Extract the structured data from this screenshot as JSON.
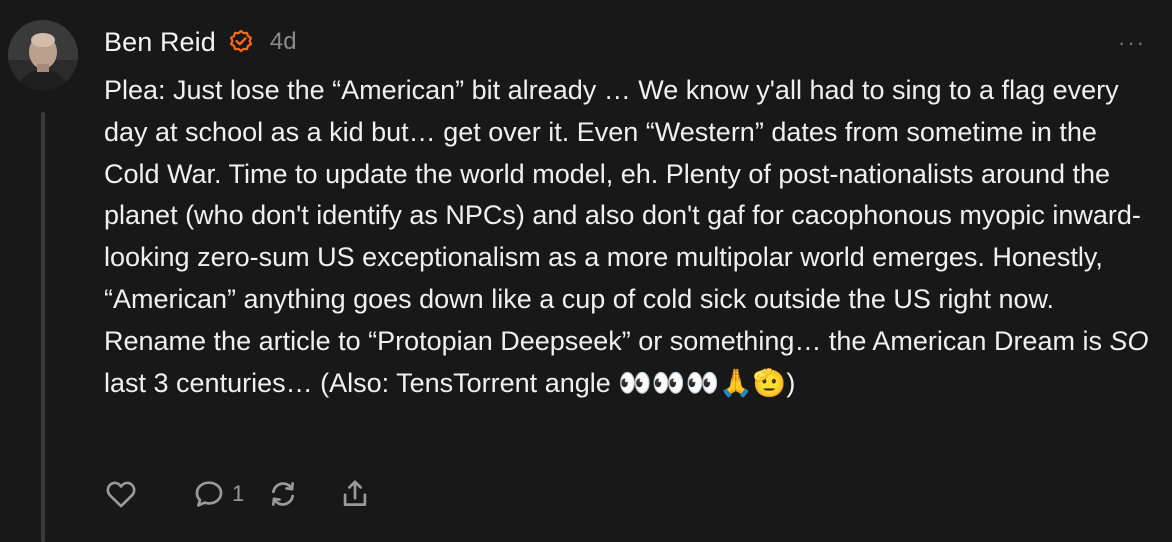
{
  "comment": {
    "author": "Ben Reid",
    "verified_icon": "verified-check-icon",
    "time_ago": "4d",
    "more_icon": "ellipsis-icon",
    "more_label": "···",
    "body_part1": "Plea: Just lose the “American” bit already … We know y'all had to sing to a flag every day at school as a kid but… get over it. Even “Western” dates from sometime in the Cold War. Time to update the world model, eh. Plenty of post-nationalists around the planet (who don't identify as NPCs) and also don't gaf for cacophonous myopic inward-looking zero-sum US exceptionalism as a more multipolar world emerges. Honestly, “American” anything goes down like a cup of cold sick outside the US right now. Rename the article to “Protopian Deepseek” or something… the American Dream is ",
    "body_emphasis": "SO",
    "body_part2": " last 3 centuries… (Also: TensTorrent angle 👀👀👀🙏🫡)",
    "actions": {
      "like_icon": "heart-icon",
      "reply_icon": "speech-bubble-icon",
      "reply_count": "1",
      "restack_icon": "restack-icon",
      "share_icon": "share-icon"
    },
    "colors": {
      "background": "#181818",
      "text": "#f0f0f0",
      "muted": "#8a8a8a",
      "verified": "#ff6719"
    }
  }
}
